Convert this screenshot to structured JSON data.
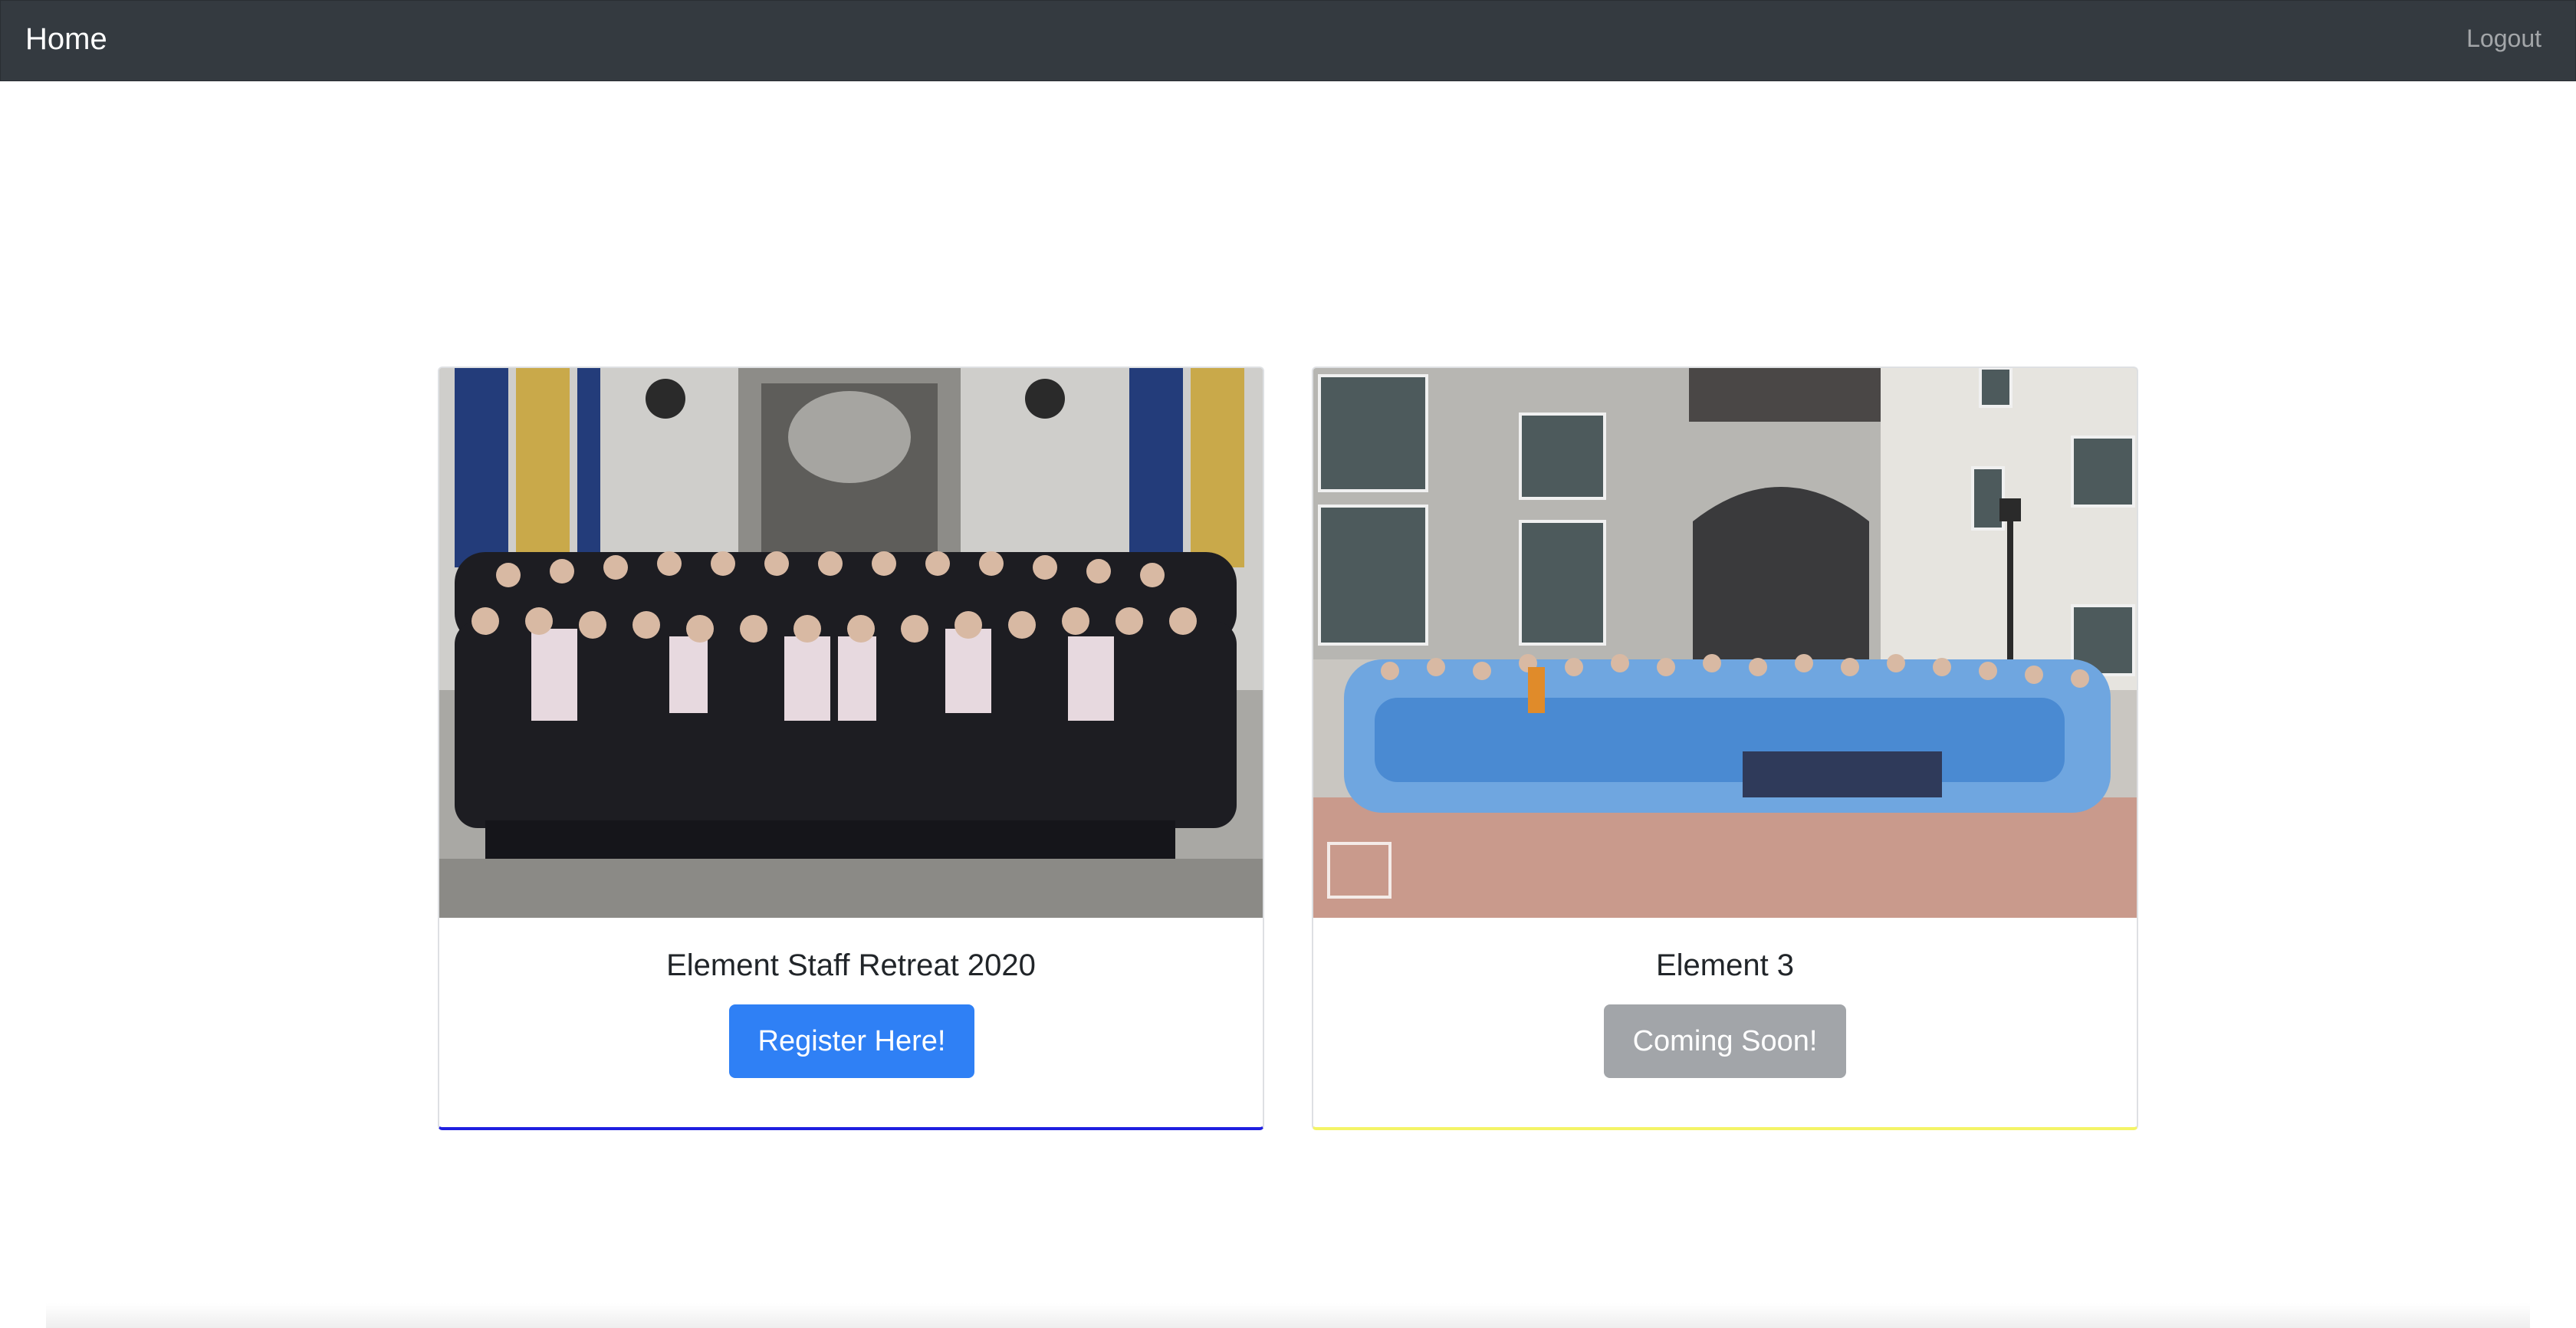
{
  "nav": {
    "brand": "Home",
    "logout": "Logout"
  },
  "cards": [
    {
      "title": "Element Staff Retreat 2020",
      "button": "Register Here!",
      "accent": "#1f1fe0",
      "button_color": "#2f80f5"
    },
    {
      "title": "Element 3",
      "button": "Coming Soon!",
      "accent": "#f4f466",
      "button_color": "#a2a5a9"
    }
  ],
  "colors": {
    "navbar": "#343a40"
  }
}
